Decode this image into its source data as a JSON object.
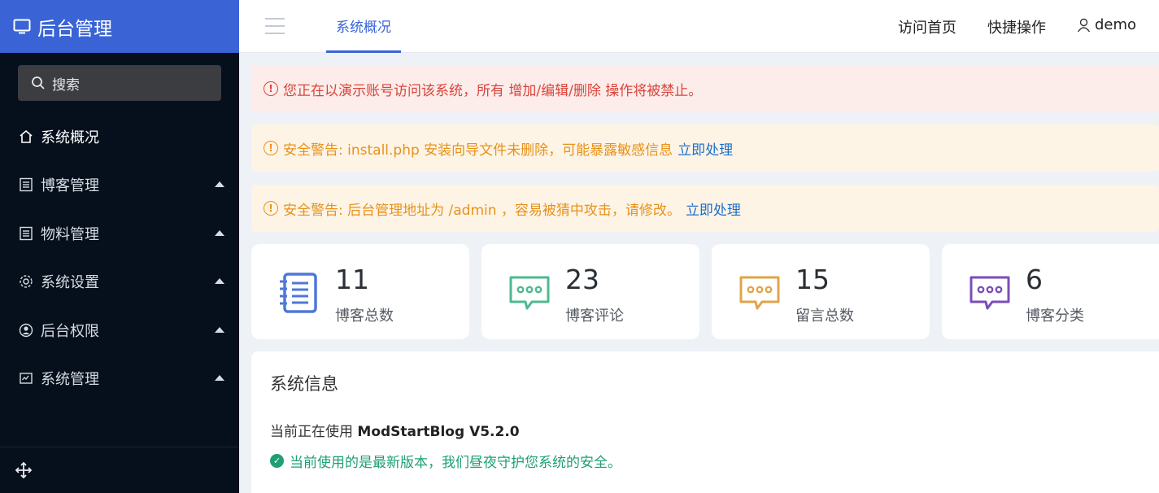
{
  "sidebar": {
    "brand": "后台管理",
    "search_label": "搜索",
    "items": [
      {
        "label": "系统概况",
        "icon": "home-icon"
      },
      {
        "label": "博客管理",
        "icon": "list-icon"
      },
      {
        "label": "物料管理",
        "icon": "list-icon"
      },
      {
        "label": "系统设置",
        "icon": "gear-icon"
      },
      {
        "label": "后台权限",
        "icon": "user-circle-icon"
      },
      {
        "label": "系统管理",
        "icon": "monitor-icon"
      }
    ]
  },
  "header": {
    "active_tab": "系统概况",
    "visit_home": "访问首页",
    "quick_ops": "快捷操作",
    "username": "demo"
  },
  "alerts": {
    "demo": "您正在以演示账号访问该系统，所有 增加/编辑/删除 操作将被禁止。",
    "install_warning": "安全警告: install.php 安装向导文件未删除，可能暴露敏感信息",
    "admin_warning": "安全警告: 后台管理地址为 /admin ，容易被猜中攻击，请修改。",
    "fix_link": "立即处理"
  },
  "stats": [
    {
      "value": "11",
      "label": "博客总数",
      "icon": "notebook-icon",
      "color": "#4e78d8"
    },
    {
      "value": "23",
      "label": "博客评论",
      "icon": "comment-icon",
      "color": "#4fb98f"
    },
    {
      "value": "15",
      "label": "留言总数",
      "icon": "comment-icon",
      "color": "#e0a54a"
    },
    {
      "value": "6",
      "label": "博客分类",
      "icon": "comment-icon",
      "color": "#7b4db8"
    }
  ],
  "system_info": {
    "title": "系统信息",
    "using_prefix": "当前正在使用",
    "version": "ModStartBlog V5.2.0",
    "latest_msg": "当前使用的是最新版本，我们昼夜守护您系统的安全。"
  }
}
